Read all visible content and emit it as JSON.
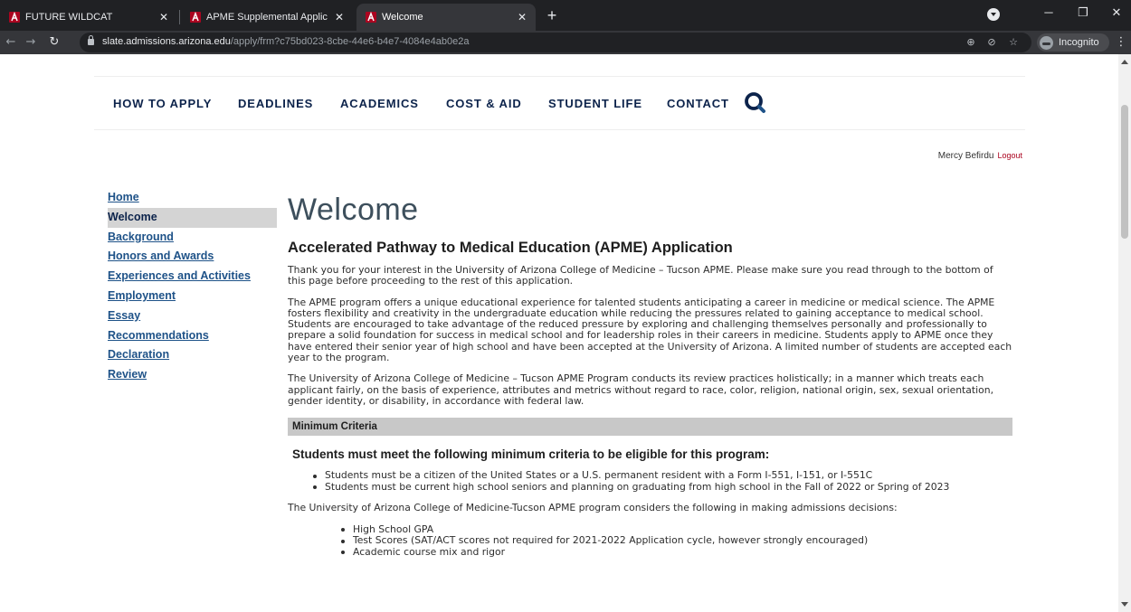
{
  "browser": {
    "tabs": [
      {
        "title": "FUTURE WILDCAT",
        "active": false
      },
      {
        "title": "APME Supplemental Application",
        "active": false
      },
      {
        "title": "Welcome",
        "active": true
      }
    ],
    "new_tab_label": "+",
    "url_host": "slate.admissions.arizona.edu",
    "url_path": "/apply/frm?c75bd023-8cbe-44e6-b4e7-4084e4ab0e2a",
    "profile_label": "Incognito"
  },
  "site_nav": {
    "items": [
      "HOW TO APPLY",
      "DEADLINES",
      "ACADEMICS",
      "COST & AID",
      "STUDENT LIFE",
      "CONTACT"
    ]
  },
  "user": {
    "name": "Mercy Befirdu",
    "logout_label": "Logout"
  },
  "sidebar": {
    "items": [
      {
        "label": "Home",
        "active": false
      },
      {
        "label": "Welcome",
        "active": true
      },
      {
        "label": "Background",
        "active": false
      },
      {
        "label": "Honors and Awards",
        "active": false
      },
      {
        "label": "Experiences and Activities",
        "active": false
      },
      {
        "label": "Employment",
        "active": false
      },
      {
        "label": "Essay",
        "active": false
      },
      {
        "label": "Recommendations",
        "active": false
      },
      {
        "label": "Declaration",
        "active": false
      },
      {
        "label": "Review",
        "active": false
      }
    ]
  },
  "content": {
    "title": "Welcome",
    "subtitle": "Accelerated Pathway to Medical Education (APME) Application",
    "para1": "Thank you for your interest in the University of Arizona College of Medicine – Tucson APME. Please make sure you read through to the bottom of this page before proceeding to the rest of this application.",
    "para2": "The APME program offers a unique educational experience for talented students anticipating a career in medicine or medical science. The APME fosters flexibility and creativity in the undergraduate education while reducing the pressures related to gaining acceptance to medical school. Students are encouraged to take advantage of the reduced pressure by exploring and challenging themselves personally and professionally to prepare a solid foundation for success in medical school and for leadership roles in their careers in medicine. Students apply to APME once they have entered their senior year of high school and have been accepted at the University of Arizona. A limited number of students are accepted each year to the program.",
    "para3": "The University of Arizona College of Medicine – Tucson APME Program conducts its review practices holistically; in a manner which treats each applicant fairly, on the basis of experience, attributes and metrics without regard to race, color, religion, national origin, sex, sexual orientation, gender identity, or disability, in accordance with federal law.",
    "section_header": "Minimum Criteria",
    "criteria_heading": "Students must meet the following minimum criteria to be eligible for this program:",
    "criteria": [
      "Students must be a citizen of the United States or a U.S. permanent resident with a Form I-551, I-151, or I-551C",
      "Students must be current high school seniors and planning on graduating from high school in the Fall of 2022 or Spring of 2023"
    ],
    "considers_text": "The University of Arizona College of Medicine-Tucson APME program considers the following in making admissions decisions:",
    "considerations": [
      "High School GPA",
      "Test Scores (SAT/ACT scores not required for 2021-2022 Application cycle, however strongly encouraged)",
      "Academic course mix and rigor"
    ]
  },
  "colors": {
    "nav_navy": "#0c234b",
    "link_blue": "#1e5288",
    "logout_red": "#ab0520",
    "heading_gray": "#3d4f5c"
  }
}
